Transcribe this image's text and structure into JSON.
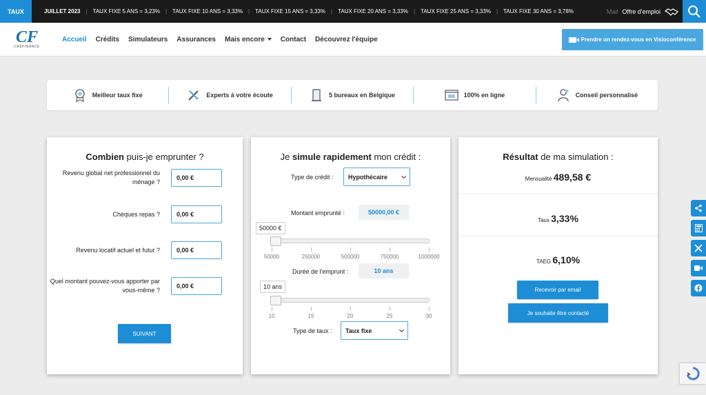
{
  "ticker": {
    "tag": "TAUX",
    "items": [
      "JUILLET 2023",
      "TAUX FIXE 5 ANS = 3,23%",
      "TAUX FIXE 10 ANS = 3,33%",
      "TAUX FIXE 15 ANS = 3,33%",
      "TAUX FIXE 20 ANS = 3,33%",
      "TAUX FIXE 25 ANS = 3,33%",
      "TAUX FIXE 30 ANS = 3,78%"
    ],
    "mail_label": "Mail",
    "jobs_label": "Offre d'emploi"
  },
  "logo": {
    "mark": "CF",
    "sub": "CRÉFINANCE"
  },
  "nav": {
    "items": [
      "Accueil",
      "Crédits",
      "Simulateurs",
      "Assurances",
      "Mais encore",
      "Contact",
      "Découvrez l'équipe"
    ],
    "cta": "Prendre un rendez-vous en Visioconférence"
  },
  "features": [
    "Meilleur taux fixe",
    "Experts à votre écoute",
    "5 bureaux en Belgique",
    "100% en ligne",
    "Conseil personnalisé"
  ],
  "card1": {
    "title_bold": "Combien",
    "title_rest": " puis-je emprunter ?",
    "fields": [
      {
        "label": "Revenu global net professionnel du ménage ?",
        "value": "0,00 €"
      },
      {
        "label": "Chèques repas ?",
        "value": "0,00 €"
      },
      {
        "label": "Revenu locatif actuel et futur ?",
        "value": "0,00 €"
      },
      {
        "label": "Quel montant pouvez-vous apporter par vous-même ?",
        "value": "0,00 €"
      }
    ],
    "next": "SUIVANT"
  },
  "card2": {
    "title_pre": "Je ",
    "title_bold": "simule rapidement",
    "title_post": " mon crédit :",
    "credit_type_label": "Type de crédit :",
    "credit_type_value": "Hypothécaire",
    "amount_label": "Montant emprunté :",
    "amount_value": "50000,00 €",
    "amount_tip": "50000 €",
    "amount_ticks": [
      "50000",
      "250000",
      "500000",
      "750000",
      "1000000"
    ],
    "amount_slider": {
      "value": 50000,
      "min": 50000,
      "max": 1000000
    },
    "duration_label": "Durée de l'emprunt :",
    "duration_value": "10 ans",
    "duration_tip": "10 ans",
    "duration_ticks": [
      "10",
      "15",
      "20",
      "25",
      "30"
    ],
    "duration_slider": {
      "value": 10,
      "min": 10,
      "max": 30
    },
    "rate_type_label": "Type de taux :",
    "rate_type_value": "Taux fixe"
  },
  "card3": {
    "title_bold": "Résultat",
    "title_rest": " de ma simulation :",
    "monthly_label": "Mensualité",
    "monthly_value": "489,58 €",
    "rate_label": "Taux",
    "rate_value": "3,33%",
    "taeg_label": "TAEG",
    "taeg_value": "6,10%",
    "email_btn": "Recevoir par email",
    "contact_btn": "Je souhaite être contacté"
  },
  "colors": {
    "accent": "#1d8ed6",
    "cta": "#4aa6de",
    "ticker_bg": "#1a1a1a"
  }
}
